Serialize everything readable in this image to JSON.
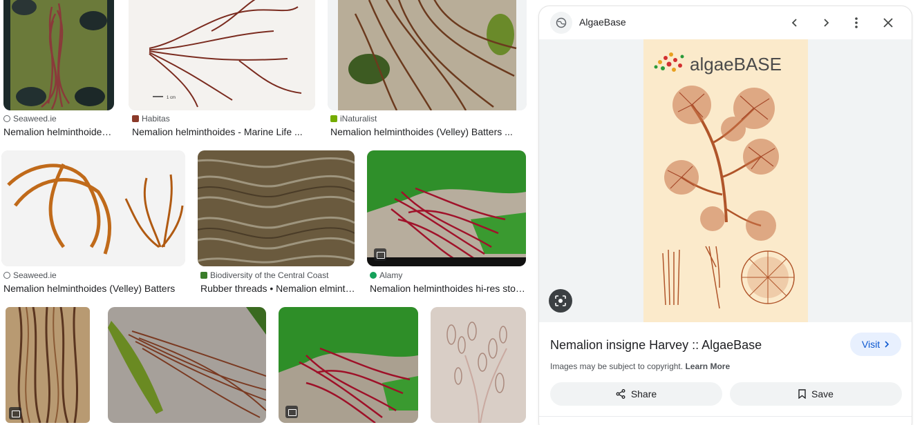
{
  "results": [
    {
      "source": "Seaweed.ie",
      "title": "Nemalion helminthoides ...",
      "fav_color": "#5f6368",
      "thumb": "brown-rope-wet"
    },
    {
      "source": "Habitas",
      "title": "Nemalion helminthoides - Marine Life ...",
      "fav_color": "#8b3a2a",
      "thumb": "branched-specimen"
    },
    {
      "source": "iNaturalist",
      "title": "Nemalion helminthoides (Velley) Batters ...",
      "fav_color": "#74ac00",
      "thumb": "brown-on-sand"
    },
    {
      "source": "Seaweed.ie",
      "title": "Nemalion helminthoides (Velley) Batters",
      "fav_color": "#5f6368",
      "thumb": "orange-specimen"
    },
    {
      "source": "Biodiversity of the Central Coast",
      "title": "Rubber threads • Nemalion elminth...",
      "fav_color": "#3a7d2a",
      "thumb": "rubber-threads"
    },
    {
      "source": "Alamy",
      "title": "Nemalion helminthoides hi-res stoc...",
      "fav_color": "#15a15a",
      "thumb": "red-on-green"
    },
    {
      "source": "",
      "title": "",
      "fav_color": "",
      "thumb": "brown-strands"
    },
    {
      "source": "",
      "title": "",
      "fav_color": "",
      "thumb": "brown-on-rock"
    },
    {
      "source": "",
      "title": "",
      "fav_color": "",
      "thumb": "red-on-green-2"
    },
    {
      "source": "",
      "title": "",
      "fav_color": "",
      "thumb": "micrograph"
    }
  ],
  "panel": {
    "site": "AlgaeBase",
    "plate_logo": "algaeBASE",
    "title": "Nemalion insigne Harvey :: AlgaeBase",
    "visit_label": "Visit",
    "copyright_text": "Images may be subject to copyright.",
    "learn_more": "Learn More",
    "share_label": "Share",
    "save_label": "Save",
    "icons": [
      "globe-icon",
      "chevron-left-icon",
      "chevron-right-icon",
      "more-vert-icon",
      "close-icon",
      "lens-icon",
      "share-icon",
      "bookmark-icon"
    ]
  },
  "colors": {
    "accent": "#0b57d0",
    "visit_bg": "#e8f0fe",
    "panel_bg": "#f1f3f4"
  }
}
